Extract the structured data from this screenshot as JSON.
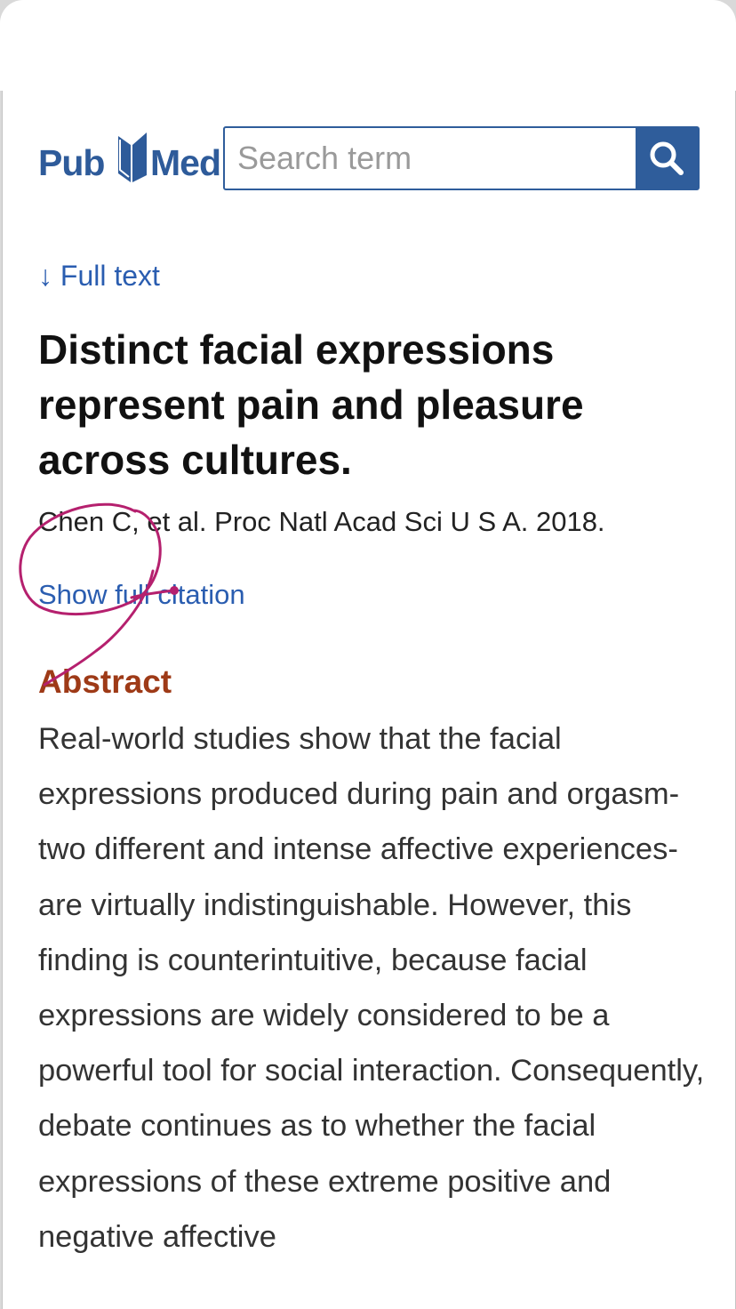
{
  "header": {
    "logo_pub": "Pub",
    "logo_med": "Med",
    "search_placeholder": "Search term",
    "search_icon": "magnifier-icon",
    "brand_color": "#2f5d9b"
  },
  "article": {
    "full_text_arrow": "↓",
    "full_text_label": "Full text",
    "title": "Distinct facial expressions represent pain and pleasure across cultures.",
    "citation": "Chen C, et al. Proc Natl Acad Sci U S A. 2018.",
    "show_citation_label": "Show full citation"
  },
  "abstract": {
    "heading": "Abstract",
    "body": "Real-world studies show that the facial expressions produced during pain and orgasm-two different and intense affective experiences-are virtually indistinguishable. However, this finding is counterintuitive, because facial expressions are widely considered to be a powerful tool for social interaction. Consequently, debate continues as to whether the facial expressions of these extreme positive and negative affective"
  },
  "colors": {
    "link": "#2a5db0",
    "abstract_heading": "#9e3a17",
    "annotation": "#b5206e"
  }
}
